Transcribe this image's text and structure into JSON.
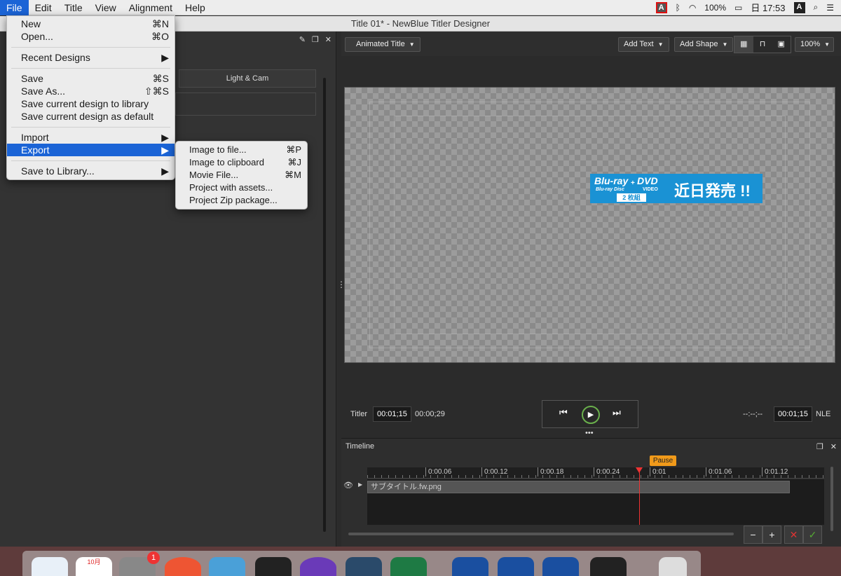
{
  "menubar": {
    "menus": [
      "File",
      "Edit",
      "Title",
      "View",
      "Alignment",
      "Help"
    ],
    "battery": "100%",
    "time": "日 17:53",
    "input_icon": "A"
  },
  "window": {
    "title": "Title 01* - NewBlue Titler Designer"
  },
  "left_panel": {
    "tab_label": "Light & Cam"
  },
  "toolbar": {
    "title_type": "Animated Title",
    "add_text": "Add Text",
    "add_shape": "Add Shape",
    "zoom": "100%",
    "view_icons": [
      "grid-icon",
      "ruler-icon",
      "frame-icon"
    ]
  },
  "banner": {
    "bluray": "Blu-ray",
    "bluray_sub": "Blu-ray Disc",
    "plus": "+",
    "dvd": "DVD",
    "video": "VIDEO",
    "badge": "2 枚組",
    "headline": "近日発売 !!"
  },
  "transport": {
    "titler_label": "Titler",
    "titler_time": "00:01;15",
    "duration": "00:00;29",
    "nle_blank": "--:--;--",
    "nle_time": "00:01;15",
    "nle_label": "NLE"
  },
  "timeline": {
    "header": "Timeline",
    "ticks": [
      "0:00.06",
      "0:00.12",
      "0:00.18",
      "0:00.24",
      "0:01",
      "0:01.06",
      "0:01.12"
    ],
    "pause_label": "Pause",
    "clip_name": "サブタイトル.fw.png",
    "btn_minus": "−",
    "btn_plus": "+",
    "btn_cancel": "✕",
    "btn_ok": "✓"
  },
  "file_menu": {
    "new": "New",
    "new_sc": "⌘N",
    "open": "Open...",
    "open_sc": "⌘O",
    "recent": "Recent Designs",
    "save": "Save",
    "save_sc": "⌘S",
    "save_as": "Save As...",
    "save_as_sc": "⇧⌘S",
    "save_lib": "Save current design to library",
    "save_default": "Save current design as default",
    "import": "Import",
    "export": "Export",
    "save_to_lib": "Save to Library..."
  },
  "export_menu": {
    "image_file": "Image to file...",
    "image_file_sc": "⌘P",
    "image_clip": "Image to clipboard",
    "image_clip_sc": "⌘J",
    "movie": "Movie File...",
    "movie_sc": "⌘M",
    "project_assets": "Project with assets...",
    "project_zip": "Project Zip package..."
  },
  "dock": {
    "calendar_month": "10月",
    "badge_count": "1"
  }
}
